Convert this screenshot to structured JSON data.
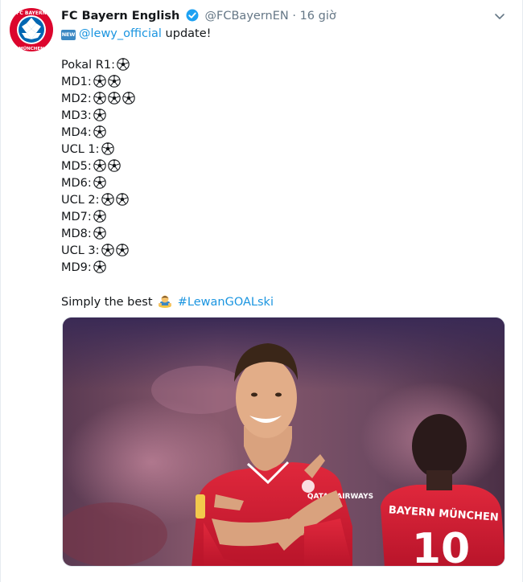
{
  "author": {
    "name": "FC Bayern English",
    "handle": "@FCBayernEN",
    "separator": "·",
    "time": "16 giờ",
    "avatar_text": "FC BAYERN MÜNCHEN"
  },
  "tweet": {
    "new_badge": "NEW",
    "mention": "@lewy_official",
    "intro_rest": " update!",
    "goals": [
      {
        "label": "Pokal R1:",
        "count": 1
      },
      {
        "label": "MD1:",
        "count": 2
      },
      {
        "label": "MD2:",
        "count": 3
      },
      {
        "label": "MD3:",
        "count": 1
      },
      {
        "label": "MD4:",
        "count": 1
      },
      {
        "label": "UCL 1:",
        "count": 1
      },
      {
        "label": "MD5:",
        "count": 2
      },
      {
        "label": "MD6:",
        "count": 1
      },
      {
        "label": "UCL 2:",
        "count": 2
      },
      {
        "label": "MD7:",
        "count": 1
      },
      {
        "label": "MD8:",
        "count": 1
      },
      {
        "label": "UCL 3:",
        "count": 2
      },
      {
        "label": "MD9:",
        "count": 1
      }
    ],
    "closing_text": "Simply the best",
    "hashtag": "#LewanGOALski"
  },
  "photo": {
    "jersey_left_text": "QATAR AIRWAYS",
    "jersey_right_text": "BAYERN MÜNCHEN",
    "jersey_number": "10"
  },
  "colors": {
    "link": "#1b95e0",
    "verified": "#1da1f2",
    "bayern_red": "#dc052d",
    "bayern_blue": "#0066b2"
  }
}
